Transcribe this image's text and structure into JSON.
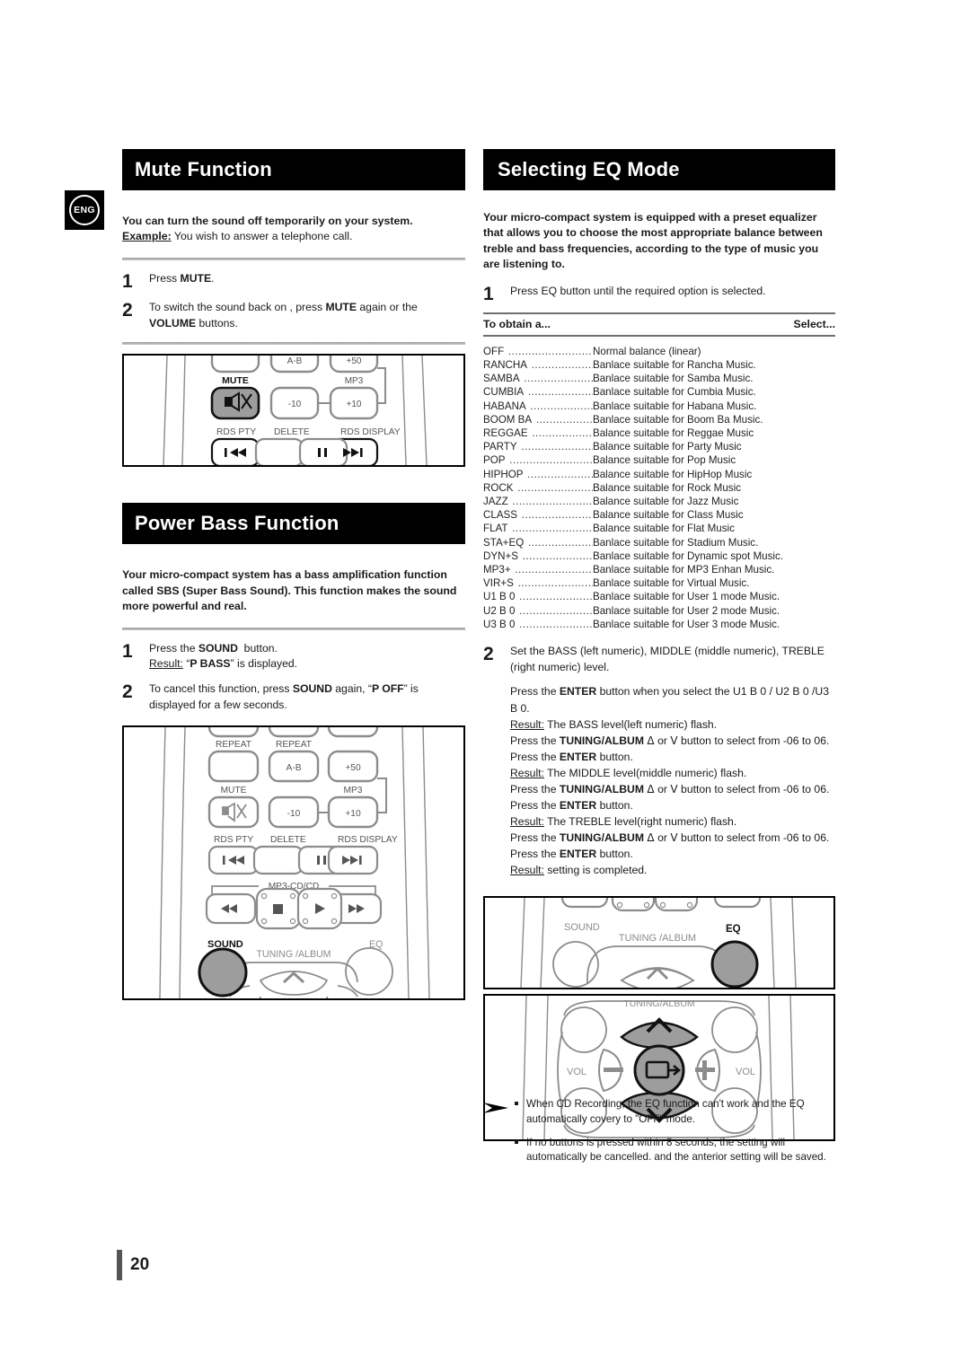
{
  "badge": {
    "label": "ENG"
  },
  "page": {
    "number": "20"
  },
  "mute": {
    "title": "Mute Function",
    "intro_bold": "You can turn the sound off temporarily on your system.",
    "example_label": "Example:",
    "example_text": " You wish to answer a telephone call.",
    "steps": [
      {
        "num": "1",
        "html": "Press <b>MUTE</b>."
      },
      {
        "num": "2",
        "html": "To switch the sound back on , press <b>MUTE</b> again or the <b>VOLUME</b> buttons."
      }
    ],
    "diagram": {
      "name": "remote-mute-detail",
      "labels": [
        "MUTE",
        "A-B",
        "+50",
        "MP3",
        "-10",
        "+10",
        "RDS PTY",
        "DELETE",
        "RDS DISPLAY"
      ],
      "highlighted_button": "MUTE"
    }
  },
  "powerbass": {
    "title": "Power Bass Function",
    "intro_bold": "Your micro-compact system has a bass amplification function called SBS (Super Bass Sound). This function makes the sound more powerful and real.",
    "steps": [
      {
        "num": "1",
        "html": "Press the <b>SOUND</b>&nbsp; button.<br><span class=\"u\">Result:</span> &ldquo;<b>P BASS</b>&rdquo; is displayed."
      },
      {
        "num": "2",
        "html": "To cancel this function, press <b>SOUND</b> again, &ldquo;<b>P OFF</b>&rdquo; is displayed for a few seconds."
      }
    ],
    "diagram": {
      "name": "remote-sound-detail",
      "labels": [
        "REPEAT",
        "REPEAT",
        "A-B",
        "+50",
        "MUTE",
        "-10",
        "MP3",
        "+10",
        "RDS PTY",
        "DELETE",
        "RDS DISPLAY",
        "MP3-CD/CD",
        "SOUND",
        "TUNING /ALBUM",
        "EQ"
      ],
      "highlighted_button": "SOUND"
    }
  },
  "eq": {
    "title": "Selecting  EQ Mode",
    "intro_bold": "Your micro-compact system is equipped with a preset equalizer that allows you to choose the most appropriate balance between treble and bass frequencies, according to the type of music you are listening to.",
    "step1": {
      "num": "1",
      "text": "Press EQ button until the required option is selected."
    },
    "table_headers": {
      "left": "To obtain a...",
      "right": "Select..."
    },
    "modes": [
      {
        "name": "OFF",
        "desc": "Normal balance (linear)"
      },
      {
        "name": "RANCHA",
        "desc": "Banlace suitable for Rancha Music."
      },
      {
        "name": "SAMBA",
        "desc": "Banlace suitable for Samba Music."
      },
      {
        "name": "CUMBIA",
        "desc": "Banlace suitable for Cumbia Music."
      },
      {
        "name": "HABANA",
        "desc": "Banlace suitable for Habana Music."
      },
      {
        "name": "BOOM BA",
        "desc": "Banlace suitable for Boom Ba Music."
      },
      {
        "name": "REGGAE",
        "desc": "Balance suitable for Reggae Music"
      },
      {
        "name": "PARTY",
        "desc": "Balance suitable for Party Music"
      },
      {
        "name": "POP",
        "desc": "Balance suitable for Pop Music"
      },
      {
        "name": "HIPHOP",
        "desc": "Balance suitable for HipHop Music"
      },
      {
        "name": "ROCK",
        "desc": "Balance suitable for Rock Music"
      },
      {
        "name": "JAZZ",
        "desc": "Balance suitable for Jazz Music"
      },
      {
        "name": "CLASS",
        "desc": "Balance suitable for Class Music"
      },
      {
        "name": "FLAT",
        "desc": "Balance suitable for Flat Music"
      },
      {
        "name": "STA+EQ",
        "desc": "Banlace suitable for Stadium Music."
      },
      {
        "name": "DYN+S",
        "desc": "Banlace suitable for Dynamic spot Music."
      },
      {
        "name": "MP3+",
        "desc": "Banlace suitable for MP3 Enhan Music."
      },
      {
        "name": "VIR+S",
        "desc": "Banlace suitable for Virtual Music."
      },
      {
        "name": "U1 B 0",
        "desc": "Banlace suitable for User 1 mode Music."
      },
      {
        "name": "U2 B 0",
        "desc": "Banlace suitable for User 2 mode Music."
      },
      {
        "name": "U3 B 0",
        "desc": "Banlace suitable for User 3 mode Music."
      }
    ],
    "step2": {
      "num": "2",
      "lead": "Set the BASS (left numeric), MIDDLE (middle numeric), TREBLE (right  numeric) level.",
      "lines": [
        {
          "html": "Press the <b>ENTER</b> button when you select the U1 B 0 / U2 B 0 /U3 B 0."
        },
        {
          "html": "<span class=\"u\">Result:</span> The BASS level(left numeric) flash."
        },
        {
          "html": "Press the <b>TUNING/ALBUM</b> <span class=\"chev\">&#5123;</span> or <span class=\"chev\">&#5167;</span> button to select from -06 to 06."
        },
        {
          "html": "Press the <b>ENTER</b> button."
        },
        {
          "html": "<span class=\"u\">Result:</span> The MIDDLE level(middle numeric) flash."
        },
        {
          "html": "Press the <b>TUNING/ALBUM</b> <span class=\"chev\">&#5123;</span> or <span class=\"chev\">&#5167;</span> button to select from -06 to 06."
        },
        {
          "html": "Press the <b>ENTER</b> button."
        },
        {
          "html": "<span class=\"u\">Result:</span> The TREBLE level(right numeric) flash."
        },
        {
          "html": "Press the <b>TUNING/ALBUM</b> <span class=\"chev\">&#5123;</span> or <span class=\"chev\">&#5167;</span> button to select from -06 to 06."
        },
        {
          "html": "Press the <b>ENTER</b> button."
        },
        {
          "html": "<span class=\"u\">Result:</span> setting is completed."
        }
      ]
    },
    "diagram_top": {
      "name": "remote-eq-detail",
      "labels": [
        "SOUND",
        "TUNING /ALBUM",
        "EQ"
      ],
      "highlighted_button": "EQ"
    },
    "diagram_bottom": {
      "name": "remote-navigation-detail",
      "labels": [
        "TUNING/ALBUM",
        "VOL",
        "VOL"
      ],
      "highlighted_buttons": [
        "up-arrow",
        "down-arrow",
        "enter"
      ]
    },
    "notes": [
      "When CD Recording, the EQ function can't work and the EQ automatically covery to \"OFF\" mode.",
      "If no buttons is pressed within 8 seconds, the setting will automatically be cancelled.  and the anterior setting will be saved."
    ]
  },
  "colors": {
    "bar_bg": "#000000",
    "highlight_gray": "#9d9d9d",
    "outline_gray": "#8c8c8c",
    "rule_gray": "#8f8f8f"
  }
}
